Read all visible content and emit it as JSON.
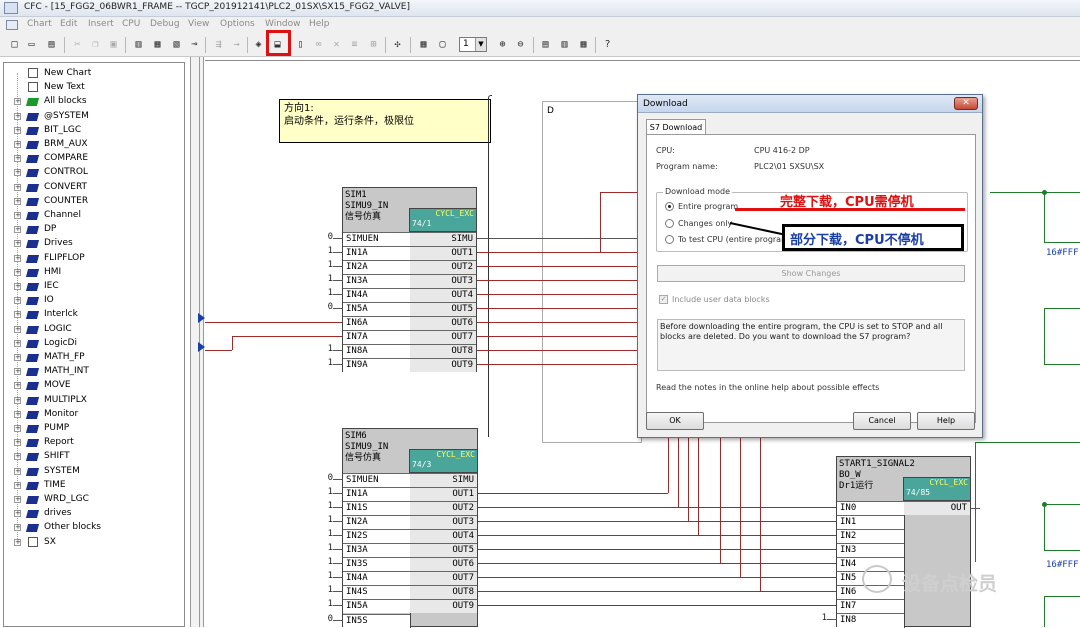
{
  "window": {
    "title": "CFC - [15_FGG2_06BWR1_FRAME -- TGCP_201912141\\PLC2_01SX\\SX15_FGG2_VALVE]"
  },
  "menu": [
    "Chart",
    "Edit",
    "Insert",
    "CPU",
    "Debug",
    "View",
    "Options",
    "Window",
    "Help"
  ],
  "toolbar": {
    "icons": [
      "new-icon",
      "open-icon",
      "print-icon",
      "cut-icon",
      "copy-icon",
      "paste-icon",
      "block-type-icon",
      "sheet-icon",
      "chart-icon",
      "connect-icon",
      "run-seq-icon",
      "interconnect-icon",
      "compile-icon",
      "download-icon",
      "test-mode-icon",
      "watch-icon",
      "delete-icon",
      "overview-icon",
      "zoom-icon",
      "sheet-view-icon",
      "page-icon",
      "zoom-in-icon",
      "zoom-out-icon",
      "tile-icon",
      "cascade-icon",
      "arrange-icon",
      "help-icon"
    ],
    "page_combo": "1"
  },
  "tree": {
    "items": [
      {
        "label": "New Chart",
        "icon": "doc"
      },
      {
        "label": "New Text",
        "icon": "doc"
      },
      {
        "label": "All blocks",
        "icon": "green"
      },
      {
        "label": "@SYSTEM"
      },
      {
        "label": "BIT_LGC"
      },
      {
        "label": "BRM_AUX"
      },
      {
        "label": "COMPARE"
      },
      {
        "label": "CONTROL"
      },
      {
        "label": "CONVERT"
      },
      {
        "label": "COUNTER"
      },
      {
        "label": "Channel"
      },
      {
        "label": "DP"
      },
      {
        "label": "Drives"
      },
      {
        "label": "FLIPFLOP"
      },
      {
        "label": "HMI"
      },
      {
        "label": "IEC"
      },
      {
        "label": "IO"
      },
      {
        "label": "Interlck"
      },
      {
        "label": "LOGIC"
      },
      {
        "label": "LogicDi"
      },
      {
        "label": "MATH_FP"
      },
      {
        "label": "MATH_INT"
      },
      {
        "label": "MOVE"
      },
      {
        "label": "MULTIPLX"
      },
      {
        "label": "Monitor"
      },
      {
        "label": "PUMP"
      },
      {
        "label": "Report"
      },
      {
        "label": "SHIFT"
      },
      {
        "label": "SYSTEM"
      },
      {
        "label": "TIME"
      },
      {
        "label": "WRD_LGC"
      },
      {
        "label": "drives"
      },
      {
        "label": "Other blocks"
      },
      {
        "label": "SX",
        "icon": "doc"
      }
    ]
  },
  "note": {
    "line1": "方向1:",
    "line2": "启动条件，运行条件，极限位"
  },
  "bg_window_char": "D",
  "block1": {
    "name": "SIM1",
    "type": "SIMU9_IN",
    "comment": "信号仿真",
    "tag": "CYCL_EXC",
    "seq": "74/1",
    "inputs": [
      {
        "n": "SIMUEN",
        "v": "0"
      },
      {
        "n": "IN1A",
        "v": "1"
      },
      {
        "n": "IN2A",
        "v": "1"
      },
      {
        "n": "IN3A",
        "v": "1"
      },
      {
        "n": "IN4A",
        "v": "1"
      },
      {
        "n": "IN5A",
        "v": "0"
      },
      {
        "n": "IN6A",
        "v": ""
      },
      {
        "n": "IN7A",
        "v": ""
      },
      {
        "n": "IN8A",
        "v": "1"
      },
      {
        "n": "IN9A",
        "v": "1"
      }
    ],
    "outputs": [
      "SIMU",
      "OUT1",
      "OUT2",
      "OUT3",
      "OUT4",
      "OUT5",
      "OUT6",
      "OUT7",
      "OUT8",
      "OUT9"
    ]
  },
  "block2": {
    "name": "SIM6",
    "type": "SIMU9_IN",
    "comment": "信号仿真",
    "tag": "CYCL_EXC",
    "seq": "74/3",
    "inputs": [
      {
        "n": "SIMUEN",
        "v": "0"
      },
      {
        "n": "IN1A",
        "v": "1"
      },
      {
        "n": "IN1S",
        "v": "1"
      },
      {
        "n": "IN2A",
        "v": "1"
      },
      {
        "n": "IN2S",
        "v": "1"
      },
      {
        "n": "IN3A",
        "v": "1"
      },
      {
        "n": "IN3S",
        "v": "1"
      },
      {
        "n": "IN4A",
        "v": "1"
      },
      {
        "n": "IN4S",
        "v": "1"
      },
      {
        "n": "IN5A",
        "v": "1"
      },
      {
        "n": "IN5S",
        "v": "0"
      }
    ],
    "outputs": [
      "SIMU",
      "OUT1",
      "OUT2",
      "OUT3",
      "OUT4",
      "OUT5",
      "OUT6",
      "OUT7",
      "OUT8",
      "OUT9"
    ]
  },
  "block3": {
    "name": "START1_SIGNAL2",
    "type": "BO_W",
    "comment": "Dr1运行",
    "tag": "CYCL_EXC",
    "seq": "74/85",
    "inputs": [
      {
        "n": "IN0",
        "v": ""
      },
      {
        "n": "IN1",
        "v": ""
      },
      {
        "n": "IN2",
        "v": ""
      },
      {
        "n": "IN3",
        "v": ""
      },
      {
        "n": "IN4",
        "v": ""
      },
      {
        "n": "IN5",
        "v": ""
      },
      {
        "n": "IN6",
        "v": ""
      },
      {
        "n": "IN7",
        "v": ""
      },
      {
        "n": "IN8",
        "v": "1"
      }
    ],
    "outputs": [
      "OUT"
    ]
  },
  "hex_labels": [
    "16#FFF",
    "16#FFF"
  ],
  "dialog": {
    "title": "Download",
    "close": "✕",
    "tab": "S7 Download",
    "cpu_label": "CPU:",
    "cpu_value": "CPU 416-2 DP",
    "prog_label": "Program name:",
    "prog_value": "PLC2\\01 SXSU\\SX",
    "mode_group": "Download mode",
    "opt_entire": "Entire program",
    "opt_changes": "Changes only",
    "opt_test": "To test CPU (entire program",
    "show_changes": "Show Changes",
    "include_label": "Include user data blocks",
    "message": "Before downloading the entire program, the CPU is set to STOP and all blocks are deleted. Do you want to download the S7 program?",
    "notes": "Read the notes in the online help about possible effects",
    "ok": "OK",
    "cancel": "Cancel",
    "help": "Help"
  },
  "annotations": {
    "entire": "完整下载，CPU需停机",
    "changes": "部分下载，CPU不停机"
  },
  "watermark": "设备点检员",
  "colors": {
    "wire": "#a02a2a",
    "green_wire": "#1d7d2a",
    "block_tag": "#4aa59a",
    "note": "#ffffc8",
    "highlight": "#e01010"
  }
}
